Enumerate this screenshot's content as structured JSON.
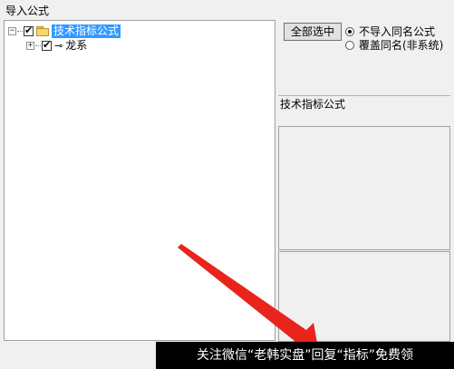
{
  "window": {
    "title": "导入公式"
  },
  "tree": {
    "nodes": [
      {
        "expander": "⊟",
        "checked": true,
        "icon": "folder-icon",
        "label": "技术指标公式",
        "selected": true
      },
      {
        "expander": "⊞",
        "checked": true,
        "icon": "key-icon",
        "label": "龙系",
        "selected": false
      }
    ]
  },
  "buttons": {
    "select_all": "全部选中"
  },
  "options": {
    "no_import_same_name": "不导入同名公式",
    "overwrite_same_name": "覆盖同名(非系统)",
    "selected": "no_import_same_name"
  },
  "right_panel": {
    "category_label": "技术指标公式"
  },
  "watermark": {
    "text": "关注微信“老韩实盘”回复“指标”免费领"
  },
  "colors": {
    "selection": "#3399ff",
    "arrow": "#e8241c"
  }
}
